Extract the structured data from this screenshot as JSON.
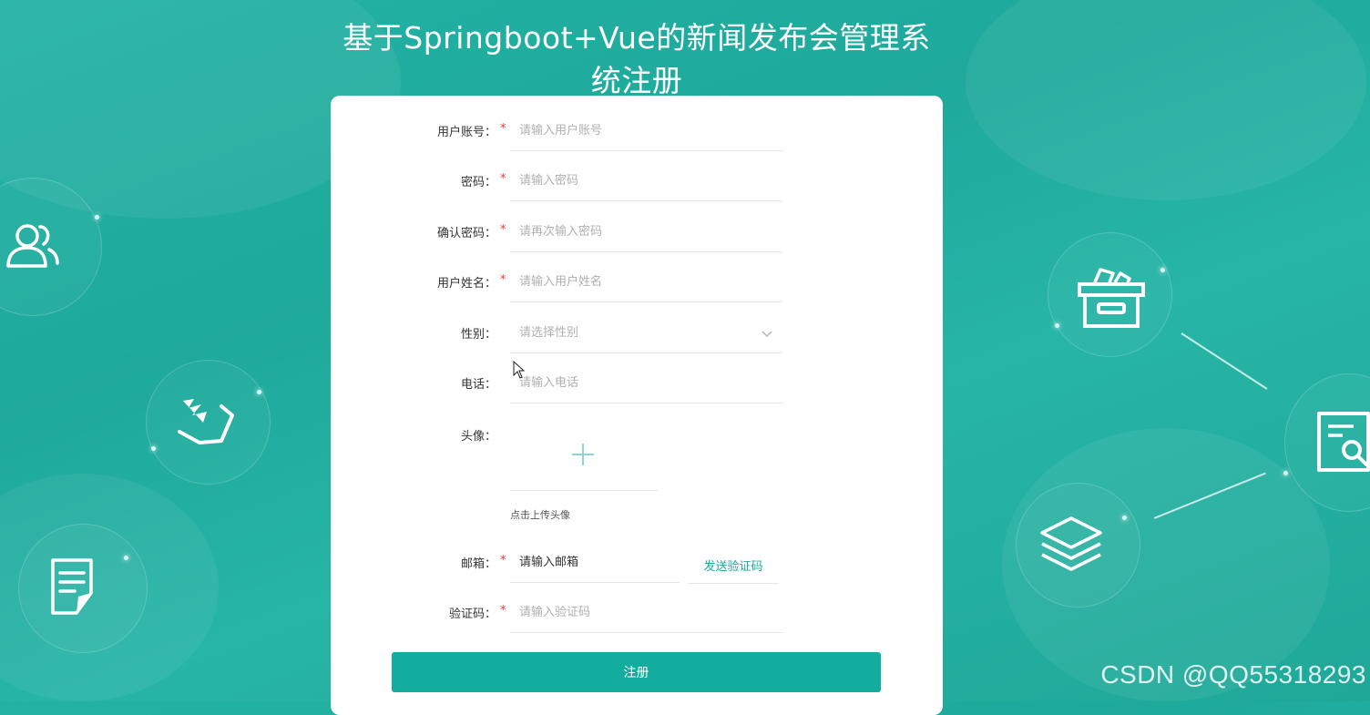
{
  "page": {
    "title": "基于Springboot+Vue的新闻发布会管理系统注册"
  },
  "form": {
    "fields": [
      {
        "label": "用户账号：",
        "placeholder": "请输入用户账号",
        "required": true
      },
      {
        "label": "密码：",
        "placeholder": "请输入密码",
        "required": true
      },
      {
        "label": "确认密码：",
        "placeholder": "请再次输入密码",
        "required": true
      },
      {
        "label": "用户姓名：",
        "placeholder": "请输入用户姓名",
        "required": true
      },
      {
        "label": "性别：",
        "placeholder": "请选择性别",
        "required": false
      },
      {
        "label": "电话：",
        "placeholder": "请输入电话",
        "required": false
      },
      {
        "label": "头像：",
        "required": false
      },
      {
        "label": "邮箱：",
        "placeholder": "请输入邮箱",
        "required": true
      },
      {
        "label": "验证码：",
        "placeholder": "请输入验证码",
        "required": true
      }
    ],
    "required_mark": "*",
    "upload_hint": "点击上传头像",
    "send_code_label": "发送验证码",
    "submit_label": "注册"
  },
  "watermark": "CSDN @QQ55318293",
  "colors": {
    "accent": "#12ad9e",
    "background": "#22b3a4",
    "required": "#e23c3c"
  },
  "icons": [
    "users-icon",
    "hand-leaf-icon",
    "document-icon",
    "archive-box-icon",
    "search-document-icon",
    "layers-icon",
    "plus-icon",
    "chevron-down-icon",
    "mouse-cursor-icon"
  ]
}
